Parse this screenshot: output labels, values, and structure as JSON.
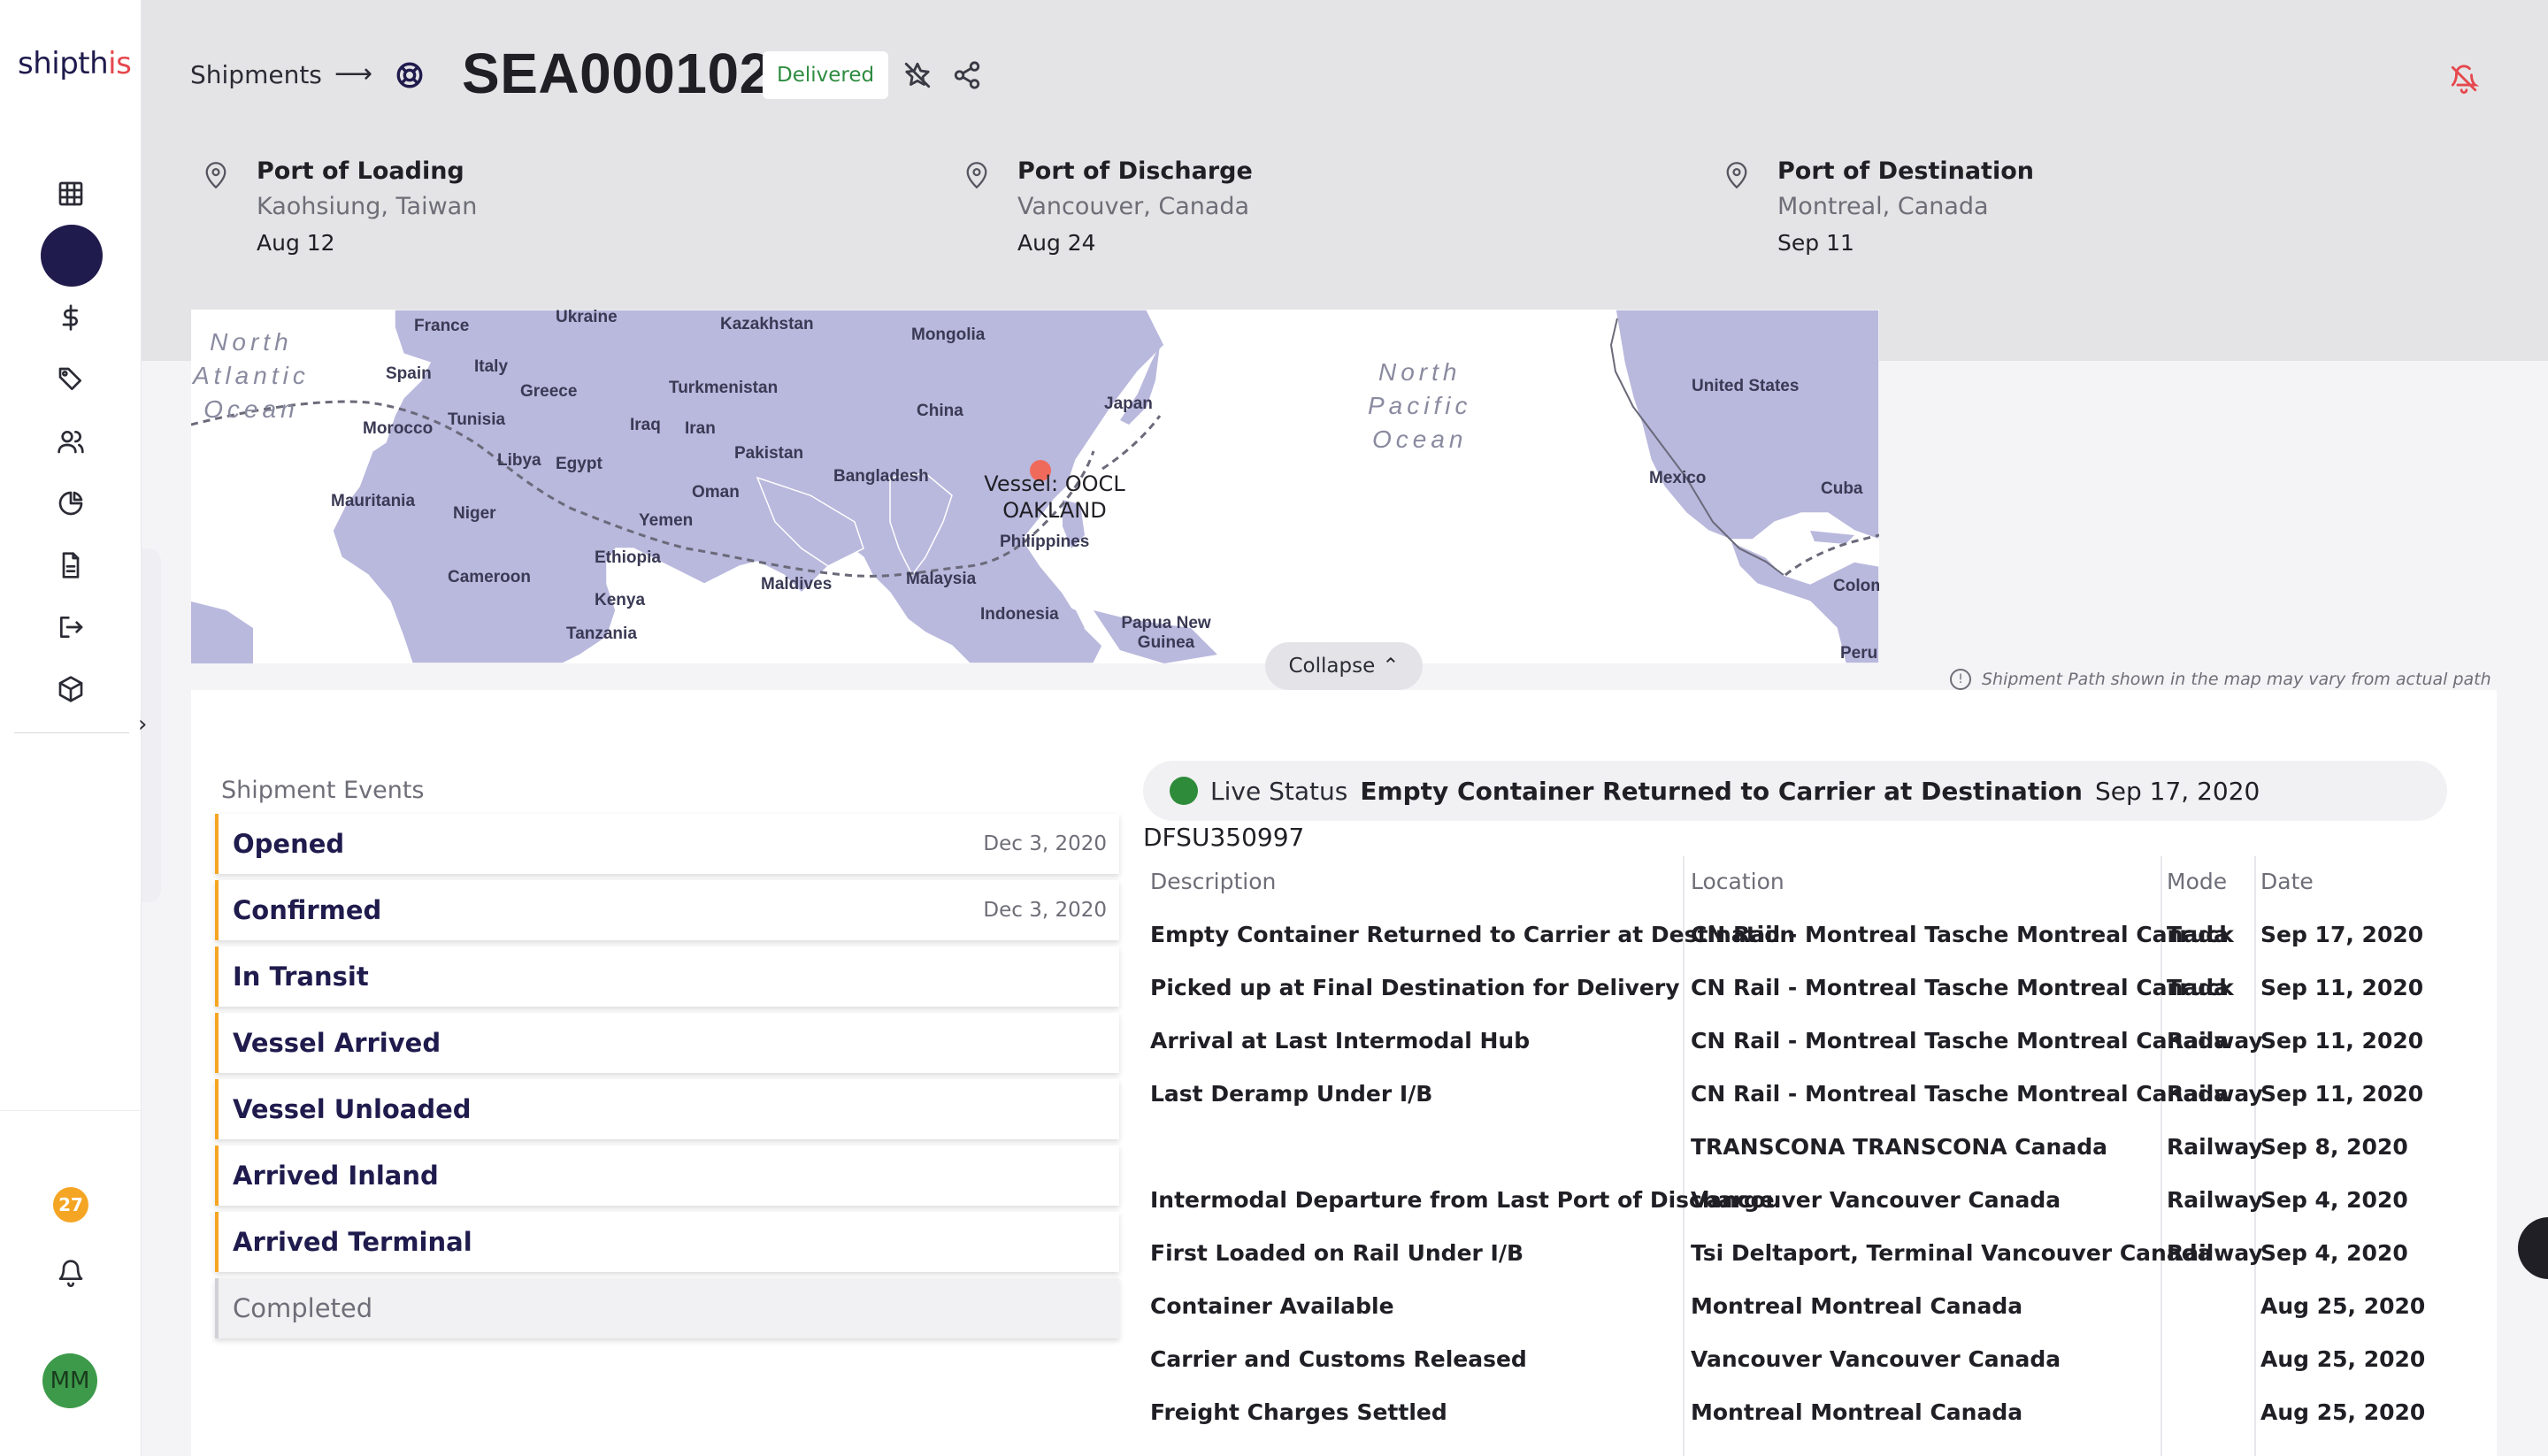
{
  "app": {
    "logo": "shipth",
    "logo_suffix": "is"
  },
  "sidebar": {
    "icons": [
      "grid-icon",
      "dashboard-active",
      "dollar-icon",
      "tag-icon",
      "users-icon",
      "pie-chart-icon",
      "document-icon",
      "logout-icon",
      "package-icon"
    ],
    "notification_count": "27",
    "avatar_initials": "MM"
  },
  "header": {
    "breadcrumb": "Shipments",
    "arrow": "⟶",
    "shipment_id": "SEA000102",
    "status": "Delivered"
  },
  "ports": [
    {
      "title": "Port of Loading",
      "location": "Kaohsiung, Taiwan",
      "date": "Aug 12"
    },
    {
      "title": "Port of Discharge",
      "location": "Vancouver, Canada",
      "date": "Aug 24"
    },
    {
      "title": "Port of Destination",
      "location": "Montreal, Canada",
      "date": "Sep 11"
    }
  ],
  "map": {
    "vessel_label_1": "Vessel: OOCL",
    "vessel_label_2": "OAKLAND",
    "ocean_labels": {
      "north_atlantic": "North\nAtlantic\nOcean",
      "north_pacific": "North\nPacific\nOcean"
    },
    "places": [
      "Ukraine",
      "France",
      "Kazakhstan",
      "Mongolia",
      "Spain",
      "Italy",
      "Greece",
      "Turkmenistan",
      "Morocco",
      "Tunisia",
      "Iraq",
      "Iran",
      "China",
      "Japan",
      "Libya",
      "Egypt",
      "Pakistan",
      "Bangladesh",
      "Mauritania",
      "Niger",
      "Oman",
      "Yemen",
      "Philippines",
      "Ethiopia",
      "Cameroon",
      "Maldives",
      "Malaysia",
      "Kenya",
      "Tanzania",
      "Indonesia",
      "Papua New Guinea",
      "United States",
      "Mexico",
      "Cuba",
      "Colom",
      "Peru"
    ],
    "collapse_label": "Collapse",
    "path_note": "Shipment Path shown in the map may vary from actual path"
  },
  "events": {
    "title": "Shipment Events",
    "items": [
      {
        "name": "Opened",
        "date": "Dec 3, 2020"
      },
      {
        "name": "Confirmed",
        "date": "Dec 3, 2020"
      },
      {
        "name": "In Transit",
        "date": ""
      },
      {
        "name": "Vessel Arrived",
        "date": ""
      },
      {
        "name": "Vessel Unloaded",
        "date": ""
      },
      {
        "name": "Arrived Inland",
        "date": ""
      },
      {
        "name": "Arrived Terminal",
        "date": ""
      },
      {
        "name": "Completed",
        "date": ""
      }
    ]
  },
  "live_status": {
    "label": "Live Status",
    "status": "Empty Container Returned to Carrier at Destination",
    "date": "Sep 17, 2020",
    "color": "#2e8b3a"
  },
  "container": {
    "id": "DFSU350997",
    "headers": [
      "Description",
      "Location",
      "Mode",
      "Date"
    ],
    "rows": [
      [
        "Empty Container Returned to Carrier at Destination",
        "CN Rail - Montreal Tasche Montreal Canada",
        "Truck",
        "Sep 17, 2020"
      ],
      [
        "Picked up at Final Destination for Delivery",
        "CN Rail - Montreal Tasche Montreal Canada",
        "Truck",
        "Sep 11, 2020"
      ],
      [
        "Arrival at Last Intermodal Hub",
        "CN Rail - Montreal Tasche Montreal Canada",
        "Railway",
        "Sep 11, 2020"
      ],
      [
        "Last Deramp Under I/B",
        "CN Rail - Montreal Tasche Montreal Canada",
        "Railway",
        "Sep 11, 2020"
      ],
      [
        "",
        "TRANSCONA TRANSCONA Canada",
        "Railway",
        "Sep 8, 2020"
      ],
      [
        "Intermodal Departure from Last Port of Discharge",
        "Vancouver Vancouver Canada",
        "Railway",
        "Sep 4, 2020"
      ],
      [
        "First Loaded on Rail Under I/B",
        "Tsi Deltaport, Terminal Vancouver Canada",
        "Railway",
        "Sep 4, 2020"
      ],
      [
        "Container Available",
        "Montreal Montreal Canada",
        "",
        "Aug 25, 2020"
      ],
      [
        "Carrier and Customs Released",
        "Vancouver Vancouver Canada",
        "",
        "Aug 25, 2020"
      ],
      [
        "Freight Charges Settled",
        "Montreal Montreal Canada",
        "",
        "Aug 25, 2020"
      ]
    ]
  },
  "colors": {
    "brand": "#1f1b4d",
    "accent": "#f5a524",
    "delivered": "#2e8b40",
    "alert": "#e5484d",
    "land": "#b9b8dd"
  }
}
